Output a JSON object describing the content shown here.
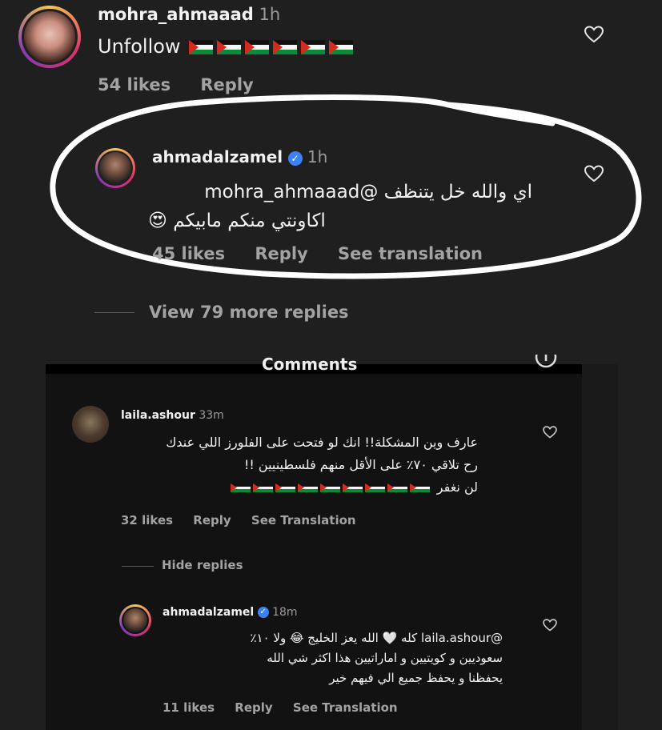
{
  "top_comment": {
    "username": "mohra_ahmaaad",
    "time": "1h",
    "text": "Unfollow",
    "flag_count": 6,
    "likes": "54 likes",
    "reply": "Reply"
  },
  "reply_comment": {
    "username": "ahmadalzamel",
    "time": "1h",
    "line1": "اي والله خل يتنظف @mohra_ahmaaad",
    "line2": "اكاونتي منكم مابيكم 😍",
    "likes": "45 likes",
    "reply": "Reply",
    "see_translation": "See translation"
  },
  "view_more": "View 79 more replies",
  "inner_screenshot": {
    "header_title": "Comments",
    "comment": {
      "username": "laila.ashour",
      "time": "33m",
      "line1": "عارف وين المشكلة!! انك لو فتحت على الفلورز اللي عندك",
      "line2": "رح تلاقي ٧٠٪ على الأقل منهم فلسطينيين !!",
      "line3": "لن نغفر",
      "flag_count": 9,
      "likes": "32 likes",
      "reply": "Reply",
      "see_translation": "See Translation"
    },
    "hide_replies": "Hide replies",
    "reply": {
      "username": "ahmadalzamel",
      "time": "18m",
      "line1": "@laila.ashour كله 🤍 الله يعز الخليج 😂 ولا ١٠٪",
      "line2": "سعوديين و كويتيين و اماراتيين هذا اكثر شي الله",
      "line3": "يحفظنا و يحفظ جميع الي فيهم خير",
      "likes": "11 likes",
      "reply": "Reply",
      "see_translation": "See Translation"
    }
  },
  "icons": {
    "heart": "heart-outline-icon",
    "verified": "verified-badge-icon",
    "info": "info-circle-icon"
  },
  "colors": {
    "background": "#1f1f1f",
    "panel": "#121212",
    "verified": "#3b82f6",
    "annotation": "#ffffff"
  }
}
